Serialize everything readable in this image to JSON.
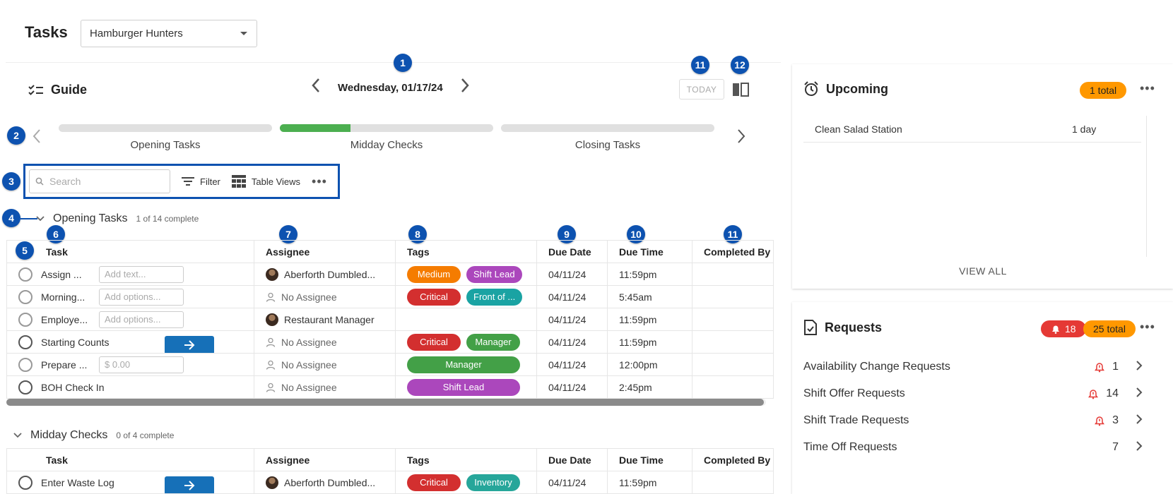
{
  "header": {
    "title": "Tasks",
    "location": "Hamburger Hunters"
  },
  "guide": {
    "label": "Guide",
    "date": "Wednesday, 01/17/24",
    "today_label": "TODAY",
    "stages": [
      {
        "label": "Opening Tasks",
        "progress": 0
      },
      {
        "label": "Midday Checks",
        "progress": 0.33
      },
      {
        "label": "Closing Tasks",
        "progress": 0
      }
    ]
  },
  "callouts": [
    "1",
    "2",
    "3",
    "4",
    "5",
    "6",
    "7",
    "8",
    "9",
    "10",
    "11",
    "11",
    "12"
  ],
  "toolbar": {
    "search_placeholder": "Search",
    "filter_label": "Filter",
    "table_views_label": "Table Views",
    "more_label": "•••"
  },
  "columns": [
    "Task",
    "Assignee",
    "Tags",
    "Due Date",
    "Due Time",
    "Completed By"
  ],
  "opening": {
    "name": "Opening Tasks",
    "count": "1 of 14 complete",
    "rows": [
      {
        "task": "Assign ...",
        "input": "Add text...",
        "assignee": "Aberforth Dumbled...",
        "avatar": true,
        "tags": [
          {
            "label": "Medium",
            "color": "#f57c00"
          },
          {
            "label": "Shift Lead",
            "color": "#ab47bc"
          }
        ],
        "due_date": "04/11/24",
        "due_time": "11:59pm"
      },
      {
        "task": "Morning...",
        "input": "Add options...",
        "assignee": "No Assignee",
        "avatar": false,
        "tags": [
          {
            "label": "Critical",
            "color": "#d32f2f"
          },
          {
            "label": "Front of ...",
            "color": "#1aa3a3"
          }
        ],
        "due_date": "04/11/24",
        "due_time": "5:45am"
      },
      {
        "task": "Employe...",
        "input": "Add options...",
        "assignee": "Restaurant Manager",
        "avatar": true,
        "tags": [],
        "due_date": "04/11/24",
        "due_time": "11:59pm"
      },
      {
        "task": "Starting Counts",
        "input": "",
        "go": true,
        "assignee": "No Assignee",
        "avatar": false,
        "tags": [
          {
            "label": "Critical",
            "color": "#d32f2f"
          },
          {
            "label": "Manager",
            "color": "#43a047"
          }
        ],
        "due_date": "04/11/24",
        "due_time": "11:59pm"
      },
      {
        "task": "Prepare ...",
        "input": "$ 0.00",
        "assignee": "No Assignee",
        "avatar": false,
        "tags": [
          {
            "label": "Manager",
            "color": "#43a047",
            "wide": true
          }
        ],
        "due_date": "04/11/24",
        "due_time": "12:00pm"
      },
      {
        "task": "BOH Check In",
        "input": "",
        "assignee": "No Assignee",
        "avatar": false,
        "tags": [
          {
            "label": "Shift Lead",
            "color": "#ab47bc",
            "wide": true
          }
        ],
        "due_date": "04/11/24",
        "due_time": "2:45pm"
      }
    ]
  },
  "midday": {
    "name": "Midday Checks",
    "count": "0 of 4 complete",
    "rows": [
      {
        "task": "Enter Waste Log",
        "input": "",
        "go": true,
        "assignee": "Aberforth Dumbled...",
        "avatar": true,
        "tags": [
          {
            "label": "Critical",
            "color": "#d32f2f"
          },
          {
            "label": "Inventory",
            "color": "#26a69a"
          }
        ],
        "due_date": "04/11/24",
        "due_time": "11:59pm"
      }
    ]
  },
  "upcoming": {
    "title": "Upcoming",
    "total": "1 total",
    "items": [
      {
        "name": "Clean Salad Station",
        "when": "1 day"
      }
    ],
    "view_all": "VIEW ALL"
  },
  "requests": {
    "title": "Requests",
    "alerts": "18",
    "total": "25 total",
    "items": [
      {
        "name": "Availability Change Requests",
        "count": "1",
        "alert": true
      },
      {
        "name": "Shift Offer Requests",
        "count": "14",
        "alert": true
      },
      {
        "name": "Shift Trade Requests",
        "count": "3",
        "alert": true
      },
      {
        "name": "Time Off Requests",
        "count": "7",
        "alert": false
      }
    ]
  },
  "colors": {
    "badge": "#0d52b0",
    "orange": "#ff9800",
    "red": "#e53935",
    "progress": "#4caf50",
    "go_button": "#1670b8"
  }
}
